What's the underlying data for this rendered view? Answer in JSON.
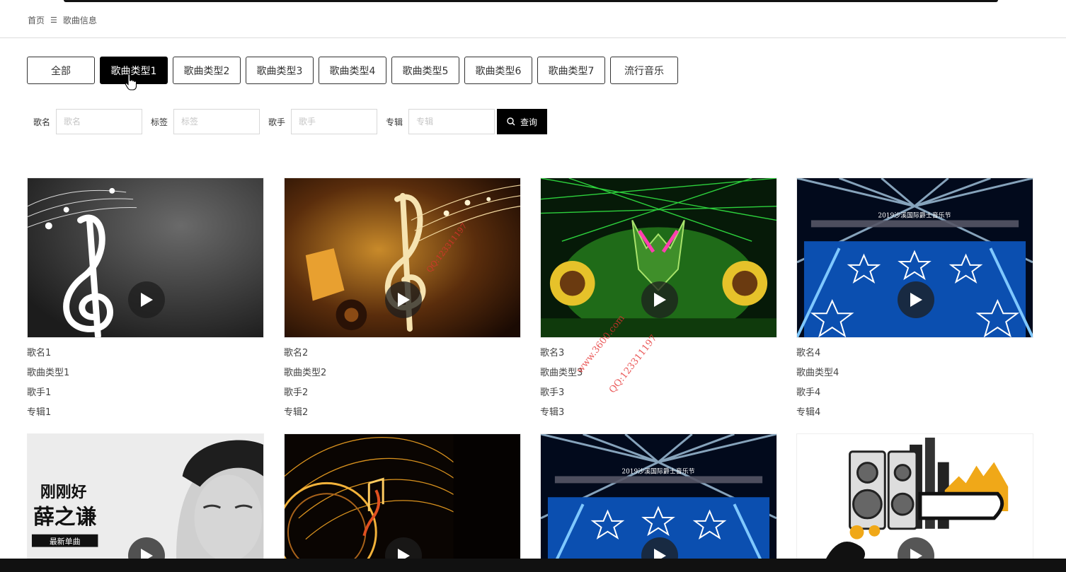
{
  "breadcrumb": {
    "home": "首页",
    "current": "歌曲信息"
  },
  "tabs": [
    "全部",
    "歌曲类型1",
    "歌曲类型2",
    "歌曲类型3",
    "歌曲类型4",
    "歌曲类型5",
    "歌曲类型6",
    "歌曲类型7",
    "流行音乐"
  ],
  "active_tab": "歌曲类型1",
  "search": {
    "name_label": "歌名",
    "name_placeholder": "歌名",
    "tag_label": "标签",
    "tag_placeholder": "标签",
    "singer_label": "歌手",
    "singer_placeholder": "歌手",
    "album_label": "专辑",
    "album_placeholder": "专辑",
    "button": "查询"
  },
  "songs": [
    {
      "name": "歌名1",
      "type": "歌曲类型1",
      "singer": "歌手1",
      "album": "专辑1",
      "thumb": "music-note-gray"
    },
    {
      "name": "歌名2",
      "type": "歌曲类型2",
      "singer": "歌手2",
      "album": "专辑2",
      "thumb": "gramophone-clef"
    },
    {
      "name": "歌名3",
      "type": "歌曲类型3",
      "singer": "歌手3",
      "album": "专辑3",
      "thumb": "green-stage"
    },
    {
      "name": "歌名4",
      "type": "歌曲类型4",
      "singer": "歌手4",
      "album": "专辑4",
      "thumb": "blue-stage"
    },
    {
      "thumb": "singer-portrait",
      "cover_text_1": "刚刚好",
      "cover_text_2": "薛之谦",
      "cover_text_3": "最新单曲"
    },
    {
      "thumb": "golden-notes"
    },
    {
      "thumb": "blue-stage"
    },
    {
      "thumb": "speaker-city"
    }
  ],
  "stage_banner": "2019沙溪国际爵士音乐节",
  "watermarks": [
    "www.3600.com",
    "QQ:123311197"
  ],
  "colors": {
    "accent": "#000000",
    "watermark": "#e53030"
  }
}
